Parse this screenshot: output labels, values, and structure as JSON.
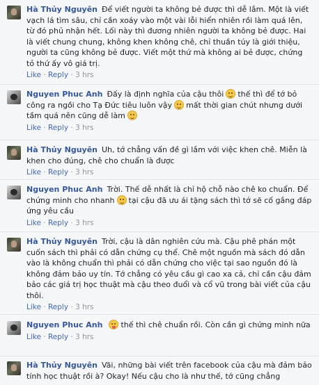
{
  "comments": [
    {
      "author": "Hà Thủy Nguyên",
      "text": "Để viết người ta không bẻ được thì dễ lắm. Một là viết vạch lá tìm sâu, chỉ cần xoáy vào một vài lỗi hiển nhiên rồi làm quá lên, từ đó phủ nhận hết. Lối này thì đương nhiên người ta không bẻ được. Hai là viết chung chung, không khen không chê, chỉ thuần túy là giới thiệu, người ta cũng không bẻ được. Viết một thứ mà không ai bẻ được, chứng tỏ thứ ấy vô giá trị.",
      "like": "Like",
      "reply": "Reply",
      "time": "3 hrs"
    },
    {
      "author": "Nguyen Phuc Anh",
      "text_parts": [
        "Đấy là định nghĩa của cậu thôi",
        "thế thì để tớ bỏ công ra ngồi cho Tạ Đức tiêu luôn vậy",
        "mất thời gian chút nhưng dưới tầm quá nên cũng dễ làm",
        ""
      ],
      "like": "Like",
      "reply": "Reply",
      "time": "3 hrs"
    },
    {
      "author": "Hà Thủy Nguyên",
      "text": "Uh, tớ chẳng vấn đề gì lắm với việc khen chê. Miễn là khen cho đúng, chê cho chuẩn là được",
      "like": "Like",
      "reply": "Reply",
      "time": "3 hrs"
    },
    {
      "author": "Nguyen Phuc Anh",
      "text_parts": [
        "Trời. Thế dễ nhất là chỉ hộ chỗ nào chê ko chuẩn. Để chứng minh cho nhanh",
        "tại cậu đã ưu ái tặng sách thì tớ sẽ cố gắng đáp ứng yêu cầu"
      ],
      "like": "Like",
      "reply": "Reply",
      "time": "3 hrs"
    },
    {
      "author": "Hà Thủy Nguyên",
      "text": "Trời, cậu là dân nghiên cứu mà. Cậu phê phán một cuốn sách thì phải có dẫn chứng cụ thể. Chê một nguồn mà sách đó dẫn vào là không chuẩn thì phải có dẫn chứng cho việc tại sao nguồn đó là không đảm bảo uy tín. Tớ chẳng có yêu cầu gì cao xa cả, chỉ cần cậu đảm bảo các giá trị học thuật mà cậu theo đuổi và cổ vũ trong bài viết của cậu thôi.",
      "like": "Like",
      "reply": "Reply",
      "time": "3 hrs"
    },
    {
      "author": "Nguyen Phuc Anh",
      "text_parts": [
        "",
        "thế thì chê chuẩn rồi. Còn cần gì chứng minh nữa"
      ],
      "like": "Like",
      "reply": "Reply",
      "time": "3 hrs"
    },
    {
      "author": "Hà Thủy Nguyên",
      "text": "Vãi, những bài viết trên facebook của cậu mà đảm bảo tính học thuật rồi à? Okay! Nếu cậu cho là như thế, tớ cũng chẳng"
    }
  ],
  "icons": {
    "emoji": "smile-emoji",
    "emoji_tongue": "tongue-emoji"
  }
}
